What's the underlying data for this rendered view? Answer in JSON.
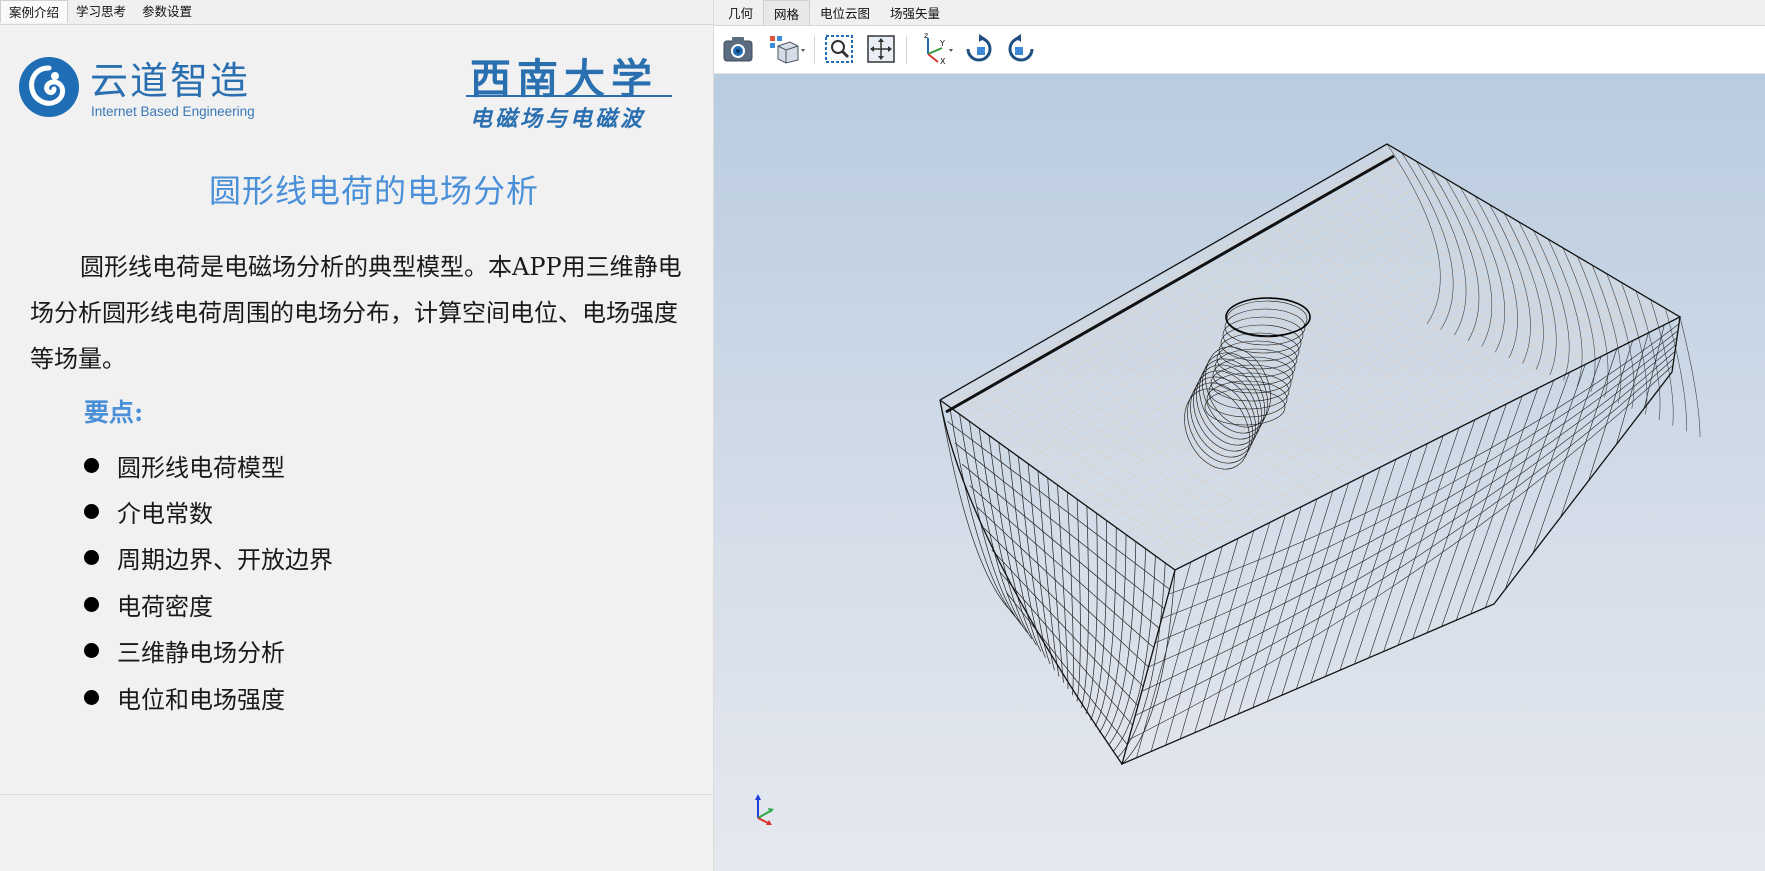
{
  "left_tabs": [
    {
      "label": "案例介绍",
      "active": true
    },
    {
      "label": "学习思考",
      "active": false
    },
    {
      "label": "参数设置",
      "active": false
    }
  ],
  "logo": {
    "name": "云道智造",
    "subtitle": "Internet Based Engineering"
  },
  "university": {
    "name": "西南大学",
    "course": "电磁场与电磁波"
  },
  "title": "圆形线电荷的电场分析",
  "intro": "圆形线电荷是电磁场分析的典型模型。本APP用三维静电场分析圆形线电荷周围的电场分布，计算空间电位、电场强度等场量。",
  "key_points": {
    "heading": "要点:",
    "items": [
      "圆形线电荷模型",
      "介电常数",
      "周期边界、开放边界",
      "电荷密度",
      "三维静电场分析",
      "电位和电场强度"
    ]
  },
  "right_tabs": [
    {
      "label": "几何",
      "active": false
    },
    {
      "label": "网格",
      "active": true
    },
    {
      "label": "电位云图",
      "active": false
    },
    {
      "label": "场强矢量",
      "active": false
    }
  ],
  "toolbar_icons": [
    "camera-icon",
    "view-cube-icon",
    "zoom-box-icon",
    "fit-view-icon",
    "axes-orientation-icon",
    "rotate-cw-icon",
    "rotate-ccw-icon"
  ],
  "colors": {
    "accent": "#4a90d9",
    "brand": "#2a6fb0"
  }
}
